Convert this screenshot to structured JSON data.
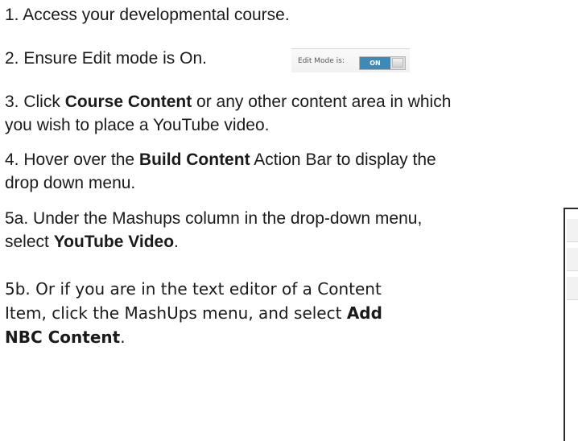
{
  "steps": {
    "s1": {
      "text": "1. Access your developmental course."
    },
    "s2": {
      "text": "2. Ensure Edit mode is On."
    },
    "s3": {
      "pre": "3. Click ",
      "bold": "Course Content",
      "post_line1": " or any other content area in which",
      "line2": "you wish to place a YouTube video."
    },
    "s4": {
      "pre": "4. Hover over the ",
      "bold": "Build Content",
      "post_line1": " Action Bar to display the",
      "line2": "drop down menu."
    },
    "s5a": {
      "line1": "5a. Under the Mashups column in the drop-down menu,",
      "pre2": "select ",
      "bold": "YouTube Video",
      "post2": "."
    },
    "s5b": {
      "line1": "5b. Or if you are in the text editor of a Content",
      "pre2": "Item, click the MashUps menu, and select ",
      "bold2": "Add",
      "bold3": "NBC Content",
      "post3": "."
    }
  },
  "edit_toggle": {
    "label": "Edit Mode is:",
    "state": "ON",
    "on_color": "#3d8ab8"
  }
}
